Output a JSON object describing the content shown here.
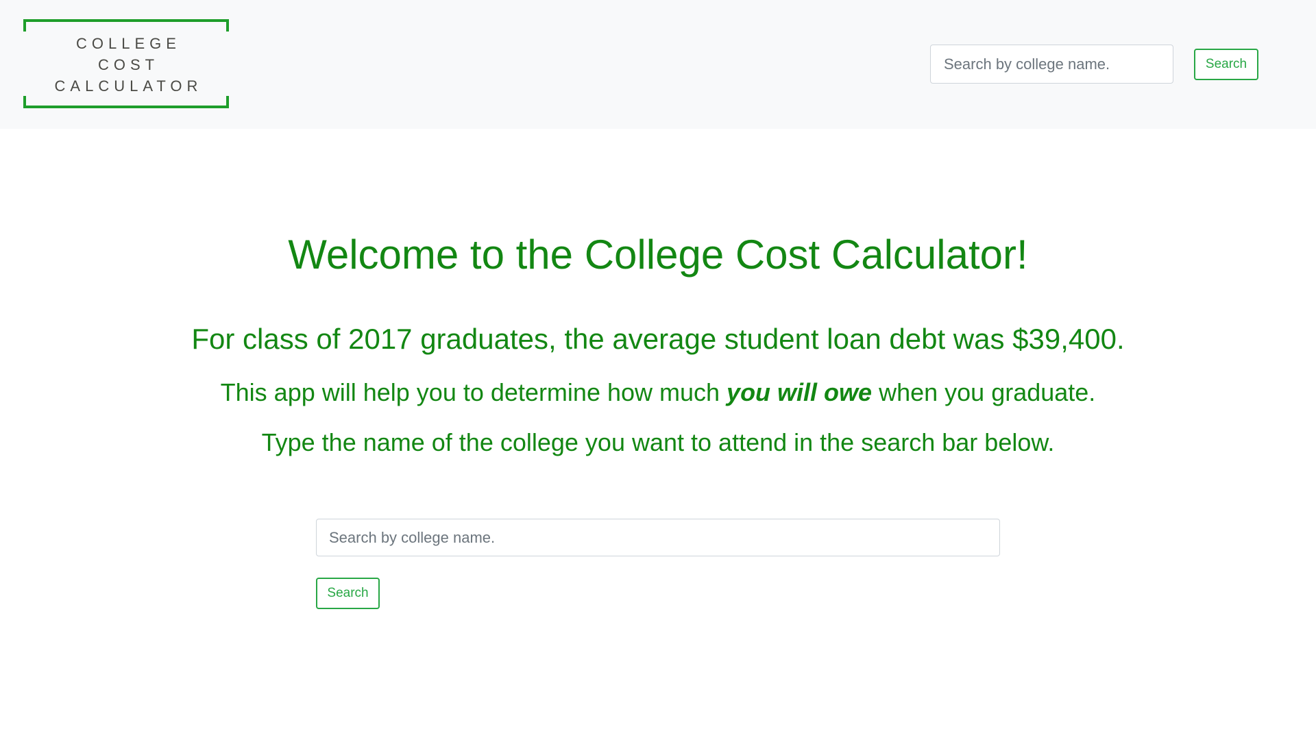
{
  "header": {
    "logo_lines": [
      "COLLEGE",
      "COST",
      "CALCULATOR"
    ],
    "search": {
      "placeholder": "Search by college name.",
      "value": "",
      "button_label": "Search"
    }
  },
  "hero": {
    "title": "Welcome to the College Cost Calculator!",
    "stat_line": "For class of 2017 graduates, the average student loan debt was $39,400.",
    "help_prefix": "This app will help you to determine how much ",
    "help_emphasis": "you will owe",
    "help_suffix": " when you graduate.",
    "instruction": "Type the name of the college you want to attend in the search bar below."
  },
  "main_search": {
    "placeholder": "Search by college name.",
    "value": "",
    "button_label": "Search"
  },
  "colors": {
    "brand_green": "#138713",
    "button_green": "#28a745",
    "logo_frame": "#1e9e2a",
    "navbar_bg": "#f8f9fa"
  }
}
